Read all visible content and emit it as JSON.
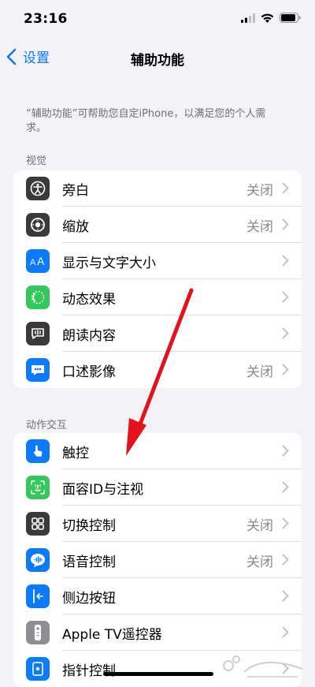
{
  "status_bar": {
    "time": "23:16"
  },
  "nav": {
    "back_label": "设置",
    "title": "辅助功能"
  },
  "intro_text": "“辅助功能”可帮助您自定iPhone，以满足您的个人需求。",
  "sections": [
    {
      "header": "视觉",
      "items": [
        {
          "label": "旁白",
          "value": "关闭",
          "icon": "voiceover-icon",
          "color": "#3a3a3c"
        },
        {
          "label": "缩放",
          "value": "关闭",
          "icon": "zoom-icon",
          "color": "#3a3a3c"
        },
        {
          "label": "显示与文字大小",
          "value": "",
          "icon": "text-size-icon",
          "color": "#0a7aff"
        },
        {
          "label": "动态效果",
          "value": "",
          "icon": "motion-icon",
          "color": "#34c759"
        },
        {
          "label": "朗读内容",
          "value": "",
          "icon": "spoken-content-icon",
          "color": "#3a3a3c"
        },
        {
          "label": "口述影像",
          "value": "关闭",
          "icon": "audio-description-icon",
          "color": "#0a7aff"
        }
      ]
    },
    {
      "header": "动作交互",
      "items": [
        {
          "label": "触控",
          "value": "",
          "icon": "touch-icon",
          "color": "#0a7aff"
        },
        {
          "label": "面容ID与注视",
          "value": "",
          "icon": "face-id-icon",
          "color": "#34c759"
        },
        {
          "label": "切换控制",
          "value": "关闭",
          "icon": "switch-control-icon",
          "color": "#3a3a3c"
        },
        {
          "label": "语音控制",
          "value": "关闭",
          "icon": "voice-control-icon",
          "color": "#0a7aff"
        },
        {
          "label": "侧边按钮",
          "value": "",
          "icon": "side-button-icon",
          "color": "#0a7aff"
        },
        {
          "label": "Apple TV遥控器",
          "value": "",
          "icon": "apple-tv-remote-icon",
          "color": "#8e8e93"
        },
        {
          "label": "指针控制",
          "value": "",
          "icon": "pointer-control-icon",
          "color": "#0a7aff"
        }
      ]
    }
  ],
  "annotation": {
    "arrow_color": "#e3121b"
  }
}
